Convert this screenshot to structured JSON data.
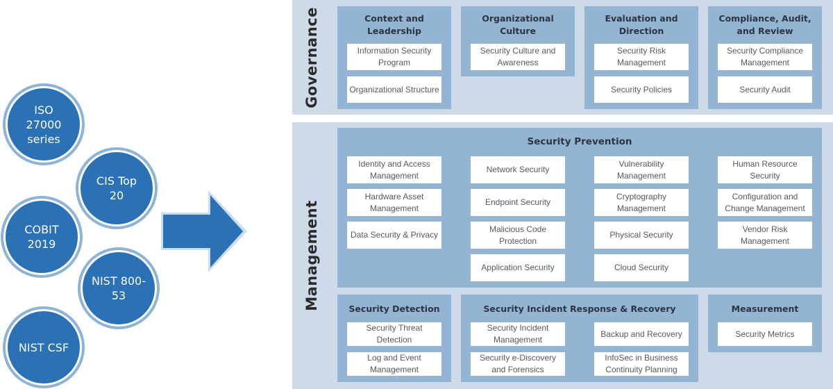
{
  "frameworks": [
    {
      "label": "ISO\n27000\nseries"
    },
    {
      "label": "CIS Top\n20"
    },
    {
      "label": "COBIT\n2019"
    },
    {
      "label": "NIST 800-\n53"
    },
    {
      "label": "NIST CSF"
    }
  ],
  "arrow": {
    "icon": "right-arrow-icon",
    "fill": "#2a72b5",
    "outline": "#c9ddef"
  },
  "colors": {
    "circle_fill": "#2a72b5",
    "section_bg": "#cddbe9",
    "group_bg": "#93b5d3",
    "box_bg": "#ffffff"
  },
  "governance": {
    "label": "Governance",
    "groups": [
      {
        "title": "Context and\nLeadership",
        "items": [
          "Information Security\nProgram",
          "Organizational Structure"
        ]
      },
      {
        "title": "Organizational\nCulture",
        "items": [
          "Security Culture and\nAwareness"
        ]
      },
      {
        "title": "Evaluation and\nDirection",
        "items": [
          "Security Risk\nManagement",
          "Security Policies"
        ]
      },
      {
        "title": "Compliance, Audit,\nand Review",
        "items": [
          "Security Compliance\nManagement",
          "Security Audit"
        ]
      }
    ]
  },
  "management": {
    "label": "Management",
    "prevention": {
      "title": "Security Prevention",
      "columns": [
        [
          "Identity and Access\nManagement",
          "Hardware Asset\nManagement",
          "Data Security & Privacy"
        ],
        [
          "Network Security",
          "Endpoint Security",
          "Malicious Code\nProtection",
          "Application Security"
        ],
        [
          "Vulnerability\nManagement",
          "Cryptography\nManagement",
          "Physical Security",
          "Cloud Security"
        ],
        [
          "Human Resource\nSecurity",
          "Configuration and\nChange Management",
          "Vendor Risk\nManagement"
        ]
      ]
    },
    "detection": {
      "title": "Security Detection",
      "items": [
        "Security Threat\nDetection",
        "Log and Event\nManagement"
      ]
    },
    "incident": {
      "title": "Security Incident Response & Recovery",
      "items": [
        "Security Incident\nManagement",
        "Security e-Discovery\nand Forensics",
        "Backup and Recovery",
        "InfoSec in Business\nContinuity Planning"
      ]
    },
    "measurement": {
      "title": "Measurement",
      "items": [
        "Security Metrics"
      ]
    }
  }
}
